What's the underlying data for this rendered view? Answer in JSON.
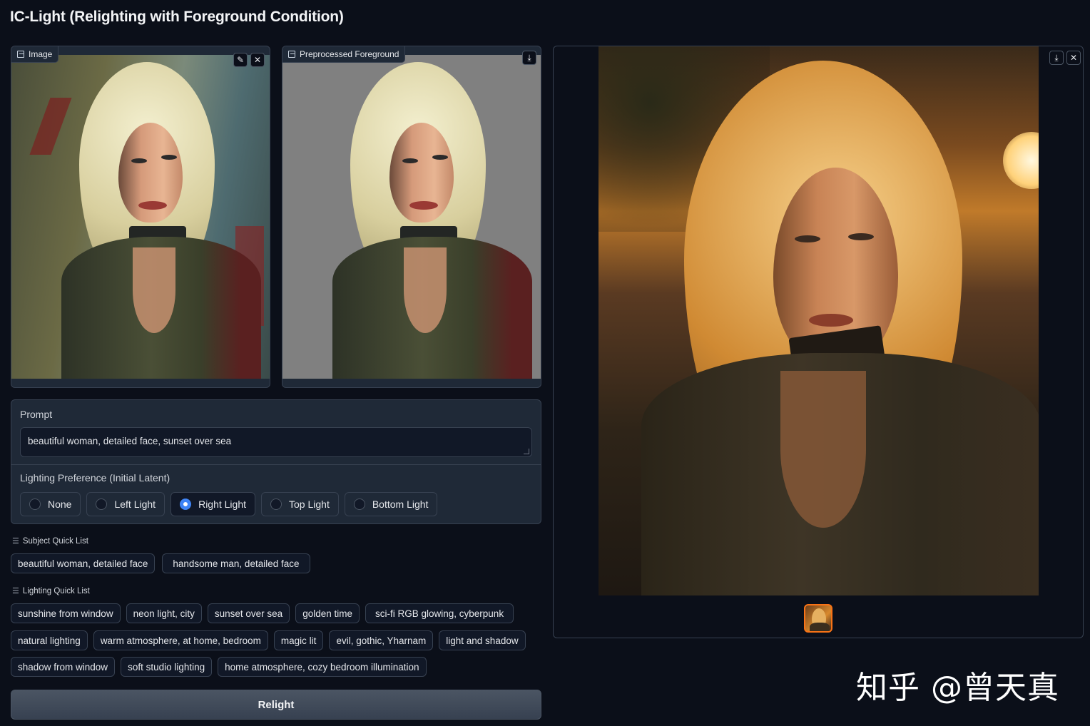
{
  "app": {
    "title": "IC-Light (Relighting with Foreground Condition)"
  },
  "image_input": {
    "label": "Image",
    "label_icon": "image-icon",
    "actions": [
      "edit-icon",
      "close-icon"
    ],
    "action_glyphs": {
      "edit": "✎",
      "close": "✕"
    }
  },
  "preprocessed": {
    "label": "Preprocessed Foreground",
    "label_icon": "image-icon",
    "actions": [
      "download-icon"
    ],
    "action_glyphs": {
      "download": "⤓"
    }
  },
  "output_gallery": {
    "actions": [
      "download-icon",
      "close-icon"
    ],
    "action_glyphs": {
      "download": "⤓",
      "close": "✕"
    },
    "thumbnail_count": 1
  },
  "prompt": {
    "label": "Prompt",
    "value": "beautiful woman, detailed face, sunset over sea"
  },
  "lighting_preference": {
    "label": "Lighting Preference (Initial Latent)",
    "options": [
      "None",
      "Left Light",
      "Right Light",
      "Top Light",
      "Bottom Light"
    ],
    "selected": "Right Light"
  },
  "subject_quick_list": {
    "title": "Subject Quick List",
    "items": [
      "beautiful woman, detailed face",
      "handsome man, detailed face"
    ]
  },
  "lighting_quick_list": {
    "title": "Lighting Quick List",
    "rows": [
      [
        "sunshine from window",
        "neon light, city",
        "sunset over sea",
        "golden time",
        "sci-fi RGB glowing, cyberpunk"
      ],
      [
        "natural lighting",
        "warm atmosphere, at home, bedroom",
        "magic lit",
        "evil, gothic, Yharnam",
        "light and shadow"
      ],
      [
        "shadow from window",
        "soft studio lighting",
        "home atmosphere, cozy bedroom illumination"
      ]
    ]
  },
  "relight_button": {
    "label": "Relight"
  },
  "watermark": {
    "text": "知乎 @曾天真"
  },
  "colors": {
    "background": "#0b0f19",
    "panel": "#1f2937",
    "border": "#374151",
    "accent": "#3b82f6",
    "thumb_border": "#f97316"
  }
}
